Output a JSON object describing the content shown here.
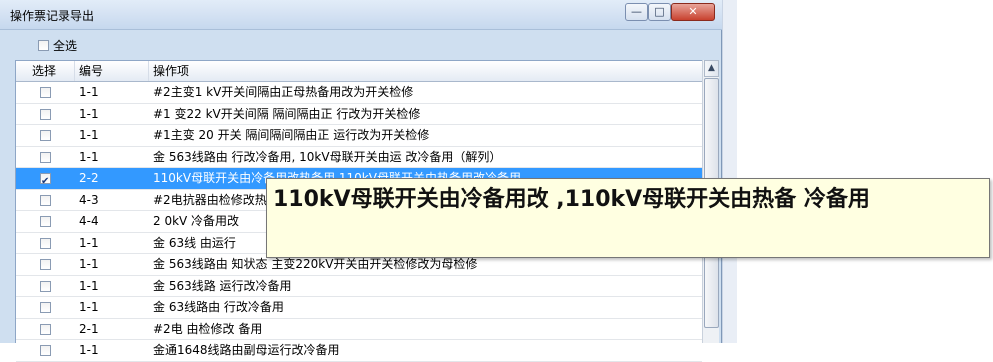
{
  "window": {
    "title": "操作票记录导出",
    "minimize_glyph": "—",
    "maximize_glyph": "□",
    "close_glyph": "✕"
  },
  "select_all": {
    "label": "全选",
    "checked": false
  },
  "grid": {
    "columns": [
      "选择",
      "编号",
      "操作项"
    ],
    "rows": [
      {
        "checked": false,
        "id": "1-1",
        "item": "#2主变1 kV开关间隔由正母热备用改为开关检修",
        "selected": false
      },
      {
        "checked": false,
        "id": "1-1",
        "item": "#1 变22 kV开关间隔 隔间隔由正 行改为开关检修",
        "selected": false
      },
      {
        "checked": false,
        "id": "1-1",
        "item": "#1主变 20 开关 隔间隔间隔由正 运行改为开关检修",
        "selected": false
      },
      {
        "checked": false,
        "id": "1-1",
        "item": "金 563线路由 行改冷备用, 10kV母联开关由运 改冷备用（解列）",
        "selected": false
      },
      {
        "checked": true,
        "id": "2-2",
        "item": "110kV母联开关由冷备用改热备用,110kV母联开关由热备用改冷备用",
        "selected": true
      },
      {
        "checked": false,
        "id": "4-3",
        "item": "#2电抗器由检修改热",
        "selected": false
      },
      {
        "checked": false,
        "id": "4-4",
        "item": "2 0kV 冷备用改",
        "selected": false
      },
      {
        "checked": false,
        "id": "1-1",
        "item": "金 63线 由运行",
        "selected": false
      },
      {
        "checked": false,
        "id": "1-1",
        "item": "金 563线路由 知状态 主变220kV开关由开关检修改为母检修",
        "selected": false
      },
      {
        "checked": false,
        "id": "1-1",
        "item": "金 563线路 运行改冷备用",
        "selected": false
      },
      {
        "checked": false,
        "id": "1-1",
        "item": "金 63线路由 行改冷备用",
        "selected": false
      },
      {
        "checked": false,
        "id": "2-1",
        "item": "#2电 由检修改 备用",
        "selected": false
      },
      {
        "checked": false,
        "id": "1-1",
        "item": "金通1648线路由副母运行改冷备用",
        "selected": false
      }
    ]
  },
  "tooltip": {
    "text": "110kV母联开关由冷备用改 ,110kV母联开关由热备 冷备用"
  },
  "colors": {
    "selection": "#3399ff",
    "tooltip_bg": "#ffffe1"
  }
}
